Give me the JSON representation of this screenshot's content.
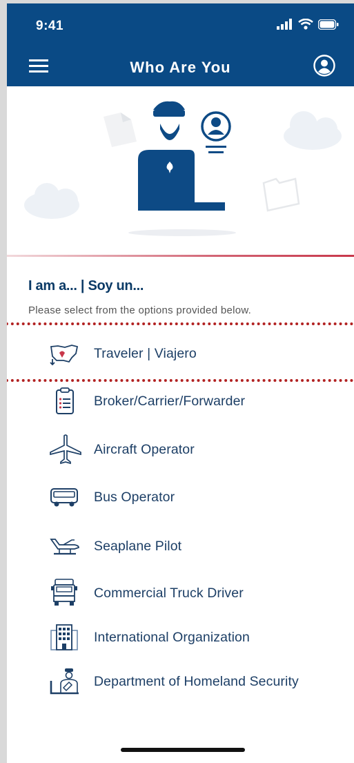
{
  "status_bar": {
    "time": "9:41"
  },
  "header": {
    "title": "Who Are You"
  },
  "heading": "I am a... | Soy un...",
  "subheading": "Please select from the options provided below.",
  "options": [
    {
      "label": "Traveler | Viajero",
      "icon": "us-map-icon"
    },
    {
      "label": "Broker/Carrier/Forwarder",
      "icon": "clipboard-icon"
    },
    {
      "label": "Aircraft Operator",
      "icon": "airplane-icon"
    },
    {
      "label": "Bus Operator",
      "icon": "bus-icon"
    },
    {
      "label": "Seaplane Pilot",
      "icon": "seaplane-icon"
    },
    {
      "label": "Commercial Truck Driver",
      "icon": "truck-icon"
    },
    {
      "label": "International Organization",
      "icon": "building-icon"
    },
    {
      "label": "Department of Homeland Security",
      "icon": "officer-desk-icon"
    }
  ],
  "colors": {
    "primary": "#0a4a85",
    "text": "#1d3f66",
    "accent": "#c8374a",
    "highlight": "#b22222"
  }
}
